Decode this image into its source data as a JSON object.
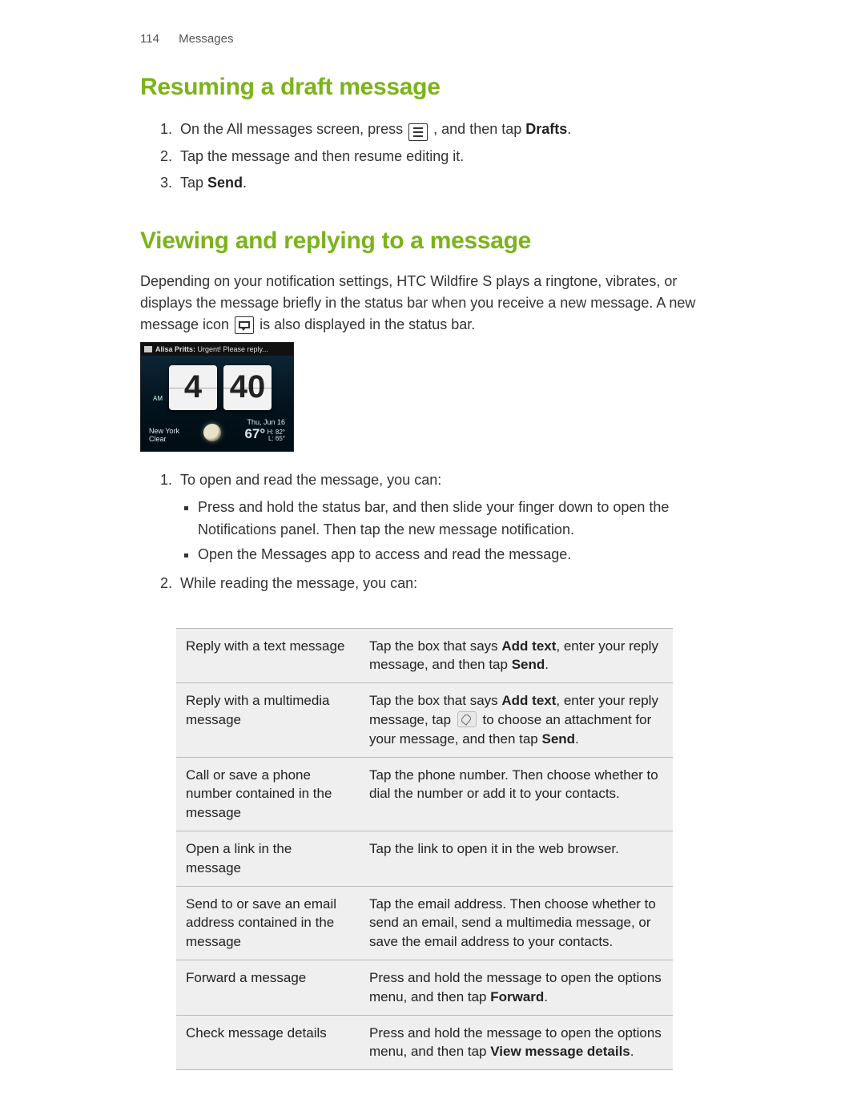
{
  "header": {
    "page_number": "114",
    "section": "Messages"
  },
  "section1": {
    "title": "Resuming a draft message",
    "steps": {
      "s1a": "On the All messages screen, press ",
      "s1b": " , and then tap ",
      "s1c": "Drafts",
      "s1d": ".",
      "s2": "Tap the message and then resume editing it.",
      "s3a": "Tap ",
      "s3b": "Send",
      "s3c": "."
    }
  },
  "section2": {
    "title": "Viewing and replying to a message",
    "intro_a": "Depending on your notification settings, HTC Wildfire S plays a ringtone, vibrates, or displays the message briefly in the status bar when you receive a new message. A new message icon ",
    "intro_b": " is also displayed in the status bar.",
    "phone": {
      "status_prefix": "Alisa Pritts:",
      "status_text": " Urgent! Please reply...",
      "hour": "4",
      "minute": "40",
      "ampm": "AM",
      "city": "New York",
      "cond": "Clear",
      "date": "Thu, Jun 16",
      "temp": "67°",
      "hi": "H: 82°",
      "lo": "L: 65°"
    },
    "step1_intro": "To open and read the message, you can:",
    "bullets": {
      "b1": "Press and hold the status bar, and then slide your finger down to open the Notifications panel. Then tap the new message notification.",
      "b2": "Open the Messages app to access and read the message."
    },
    "step2_intro": "While reading the message, you can:",
    "table": {
      "r1c1": "Reply with a text message",
      "r1c2a": "Tap the box that says ",
      "r1c2b": "Add text",
      "r1c2c": ", enter your reply message, and then tap ",
      "r1c2d": "Send",
      "r1c2e": ".",
      "r2c1": "Reply with a multimedia message",
      "r2c2a": "Tap the box that says ",
      "r2c2b": "Add text",
      "r2c2c": ", enter your reply message, tap ",
      "r2c2d": " to choose an attachment for your message, and then tap ",
      "r2c2e": "Send",
      "r2c2f": ".",
      "r3c1": "Call or save a phone number contained in the message",
      "r3c2": "Tap the phone number. Then choose whether to dial the number or add it to your contacts.",
      "r4c1": "Open a link in the message",
      "r4c2": "Tap the link to open it in the web browser.",
      "r5c1": "Send to or save an email address contained in the message",
      "r5c2": "Tap the email address. Then choose whether to send an email, send a multimedia message, or save the email address to your contacts.",
      "r6c1": "Forward a message",
      "r6c2a": "Press and hold the message to open the options menu, and then tap ",
      "r6c2b": "Forward",
      "r6c2c": ".",
      "r7c1": "Check message details",
      "r7c2a": "Press and hold the message to open the options menu, and then tap ",
      "r7c2b": "View message details",
      "r7c2c": "."
    }
  }
}
